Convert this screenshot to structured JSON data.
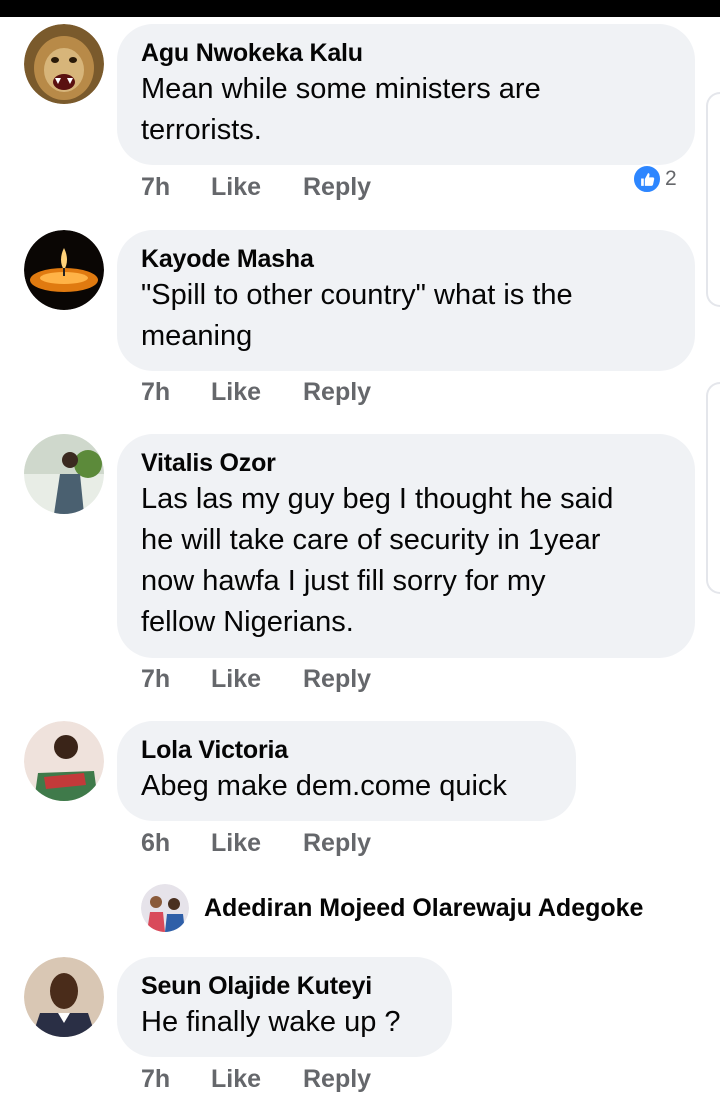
{
  "comments": [
    {
      "name": "Agu Nwokeka Kalu",
      "lines": [
        "Mean while some ministers are",
        "terrorists."
      ],
      "time": "7h",
      "like": "Like",
      "reply": "Reply",
      "reaction_count": "2"
    },
    {
      "name": "Kayode Masha",
      "lines": [
        "\"Spill to other country\" what is the",
        "meaning"
      ],
      "time": "7h",
      "like": "Like",
      "reply": "Reply"
    },
    {
      "name": "Vitalis Ozor",
      "lines": [
        "Las las my guy beg I thought he said",
        "he will take care of security in 1year",
        "now hawfa I just fill sorry for my",
        "fellow Nigerians."
      ],
      "time": "7h",
      "like": "Like",
      "reply": "Reply"
    },
    {
      "name": "Lola Victoria",
      "lines": [
        "Abeg make dem.come quick"
      ],
      "time": "6h",
      "like": "Like",
      "reply": "Reply"
    },
    {
      "name": "Seun Olajide Kuteyi",
      "lines": [
        "He finally wake up ?"
      ],
      "time": "7h",
      "like": "Like",
      "reply": "Reply"
    }
  ],
  "reply_preview": {
    "name": "Adediran Mojeed Olarewaju Adegoke"
  },
  "icons": {
    "like_reaction": "thumbs-up-icon"
  },
  "colors": {
    "bubble": "#f0f2f5",
    "meta": "#65676b",
    "like_blue": "#2d86ff"
  }
}
